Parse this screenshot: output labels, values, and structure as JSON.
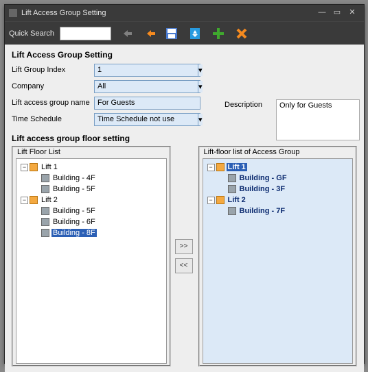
{
  "title": "Lift Access Group Setting",
  "toolbar": {
    "quick_search_label": "Quick Search",
    "search_value": ""
  },
  "form": {
    "heading": "Lift Access Group Setting",
    "index_label": "Lift Group Index",
    "index_value": "1",
    "company_label": "Company",
    "company_value": "All",
    "name_label": "Lift access group name",
    "name_value": "For Guests",
    "schedule_label": "Time Schedule",
    "schedule_value": "Time Schedule not use",
    "desc_label": "Description",
    "desc_value": "Only for Guests"
  },
  "floors": {
    "heading": "Lift access group floor setting",
    "left_title": "Lift  Floor List",
    "right_title": "Lift-floor list of Access Group",
    "move_right": ">>",
    "move_left": "<<",
    "left": {
      "lift1": "Lift 1",
      "l1a": "Building - 4F",
      "l1b": "Building - 5F",
      "lift2": "Lift 2",
      "l2a": "Building - 5F",
      "l2b": "Building - 6F",
      "l2c": "Building - 8F"
    },
    "right": {
      "lift1": "Lift 1",
      "r1a": "Building - GF",
      "r1b": "Building - 3F",
      "lift2": "Lift 2",
      "r2a": "Building - 7F"
    }
  }
}
